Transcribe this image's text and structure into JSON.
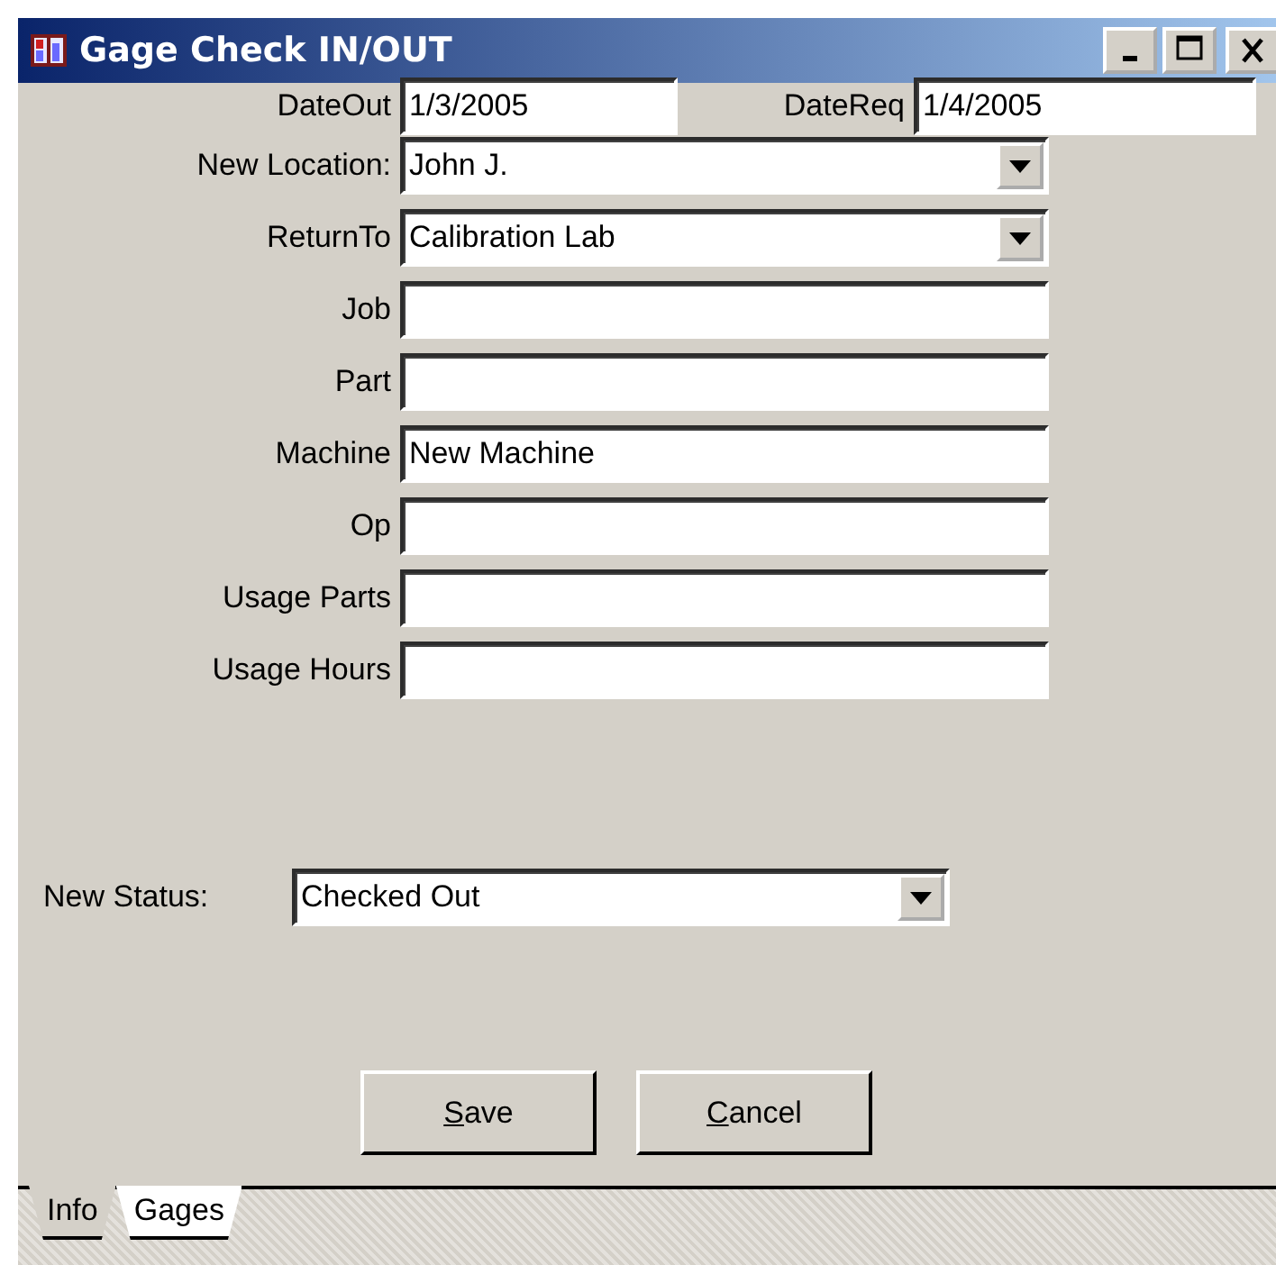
{
  "window": {
    "title": "Gage Check IN/OUT"
  },
  "date_fields": [
    {
      "label": "DateOut",
      "value": "1/3/2005"
    },
    {
      "label": "DateReq",
      "value": "1/4/2005"
    }
  ],
  "fields": [
    {
      "label": "New Location:",
      "kind": "combo",
      "value": "John J."
    },
    {
      "label": "ReturnTo",
      "kind": "combo",
      "value": "Calibration Lab"
    },
    {
      "label": "Job",
      "kind": "text"
    },
    {
      "label": "Part",
      "kind": "text"
    },
    {
      "label": "Machine",
      "kind": "text",
      "value": "New Machine"
    },
    {
      "label": "Op",
      "kind": "text"
    },
    {
      "label": "Usage Parts",
      "kind": "text"
    },
    {
      "label": "Usage Hours",
      "kind": "text"
    }
  ],
  "status": {
    "label": "New Status:",
    "value": "Checked Out"
  },
  "buttons": [
    "Save",
    "Cancel"
  ],
  "tabs": [
    {
      "label": "Info",
      "selected": true
    },
    {
      "label": "Gages",
      "selected": false
    }
  ]
}
